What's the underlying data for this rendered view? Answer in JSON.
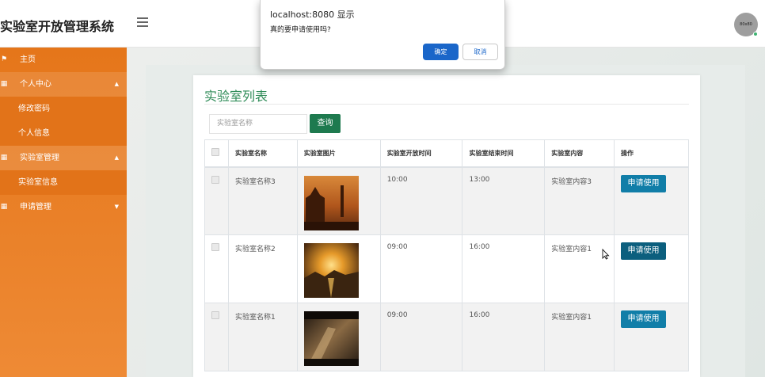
{
  "header": {
    "app_title": "实验室开放管理系统",
    "avatar_text": "80x80"
  },
  "sidebar": {
    "items": [
      {
        "label": "主页"
      },
      {
        "label": "个人中心",
        "children": [
          "修改密码",
          "个人信息"
        ]
      },
      {
        "label": "实验室管理",
        "children": [
          "实验室信息"
        ]
      },
      {
        "label": "申请管理",
        "children": []
      }
    ]
  },
  "panel": {
    "title": "实验室列表",
    "search_placeholder": "实验室名称",
    "search_button": "查询"
  },
  "table": {
    "columns": [
      "实验室名称",
      "实验室图片",
      "实验室开放时间",
      "实验室结束时间",
      "实验室内容",
      "操作"
    ],
    "rows": [
      {
        "name": "实验室名称3",
        "open": "10:00",
        "close": "13:00",
        "content": "实验室内容3",
        "action": "申请使用"
      },
      {
        "name": "实验室名称2",
        "open": "09:00",
        "close": "16:00",
        "content": "实验室内容1",
        "action": "申请使用"
      },
      {
        "name": "实验室名称1",
        "open": "09:00",
        "close": "16:00",
        "content": "实验室内容1",
        "action": "申请使用"
      }
    ]
  },
  "dialog": {
    "title": "localhost:8080 显示",
    "message": "真的要申请使用吗?",
    "ok_label": "确定",
    "cancel_label": "取消"
  },
  "colors": {
    "sidebar": "#e5761a",
    "accent_green": "#2e8b57",
    "button_blue": "#117ea8",
    "dialog_ok": "#1a66c9"
  }
}
